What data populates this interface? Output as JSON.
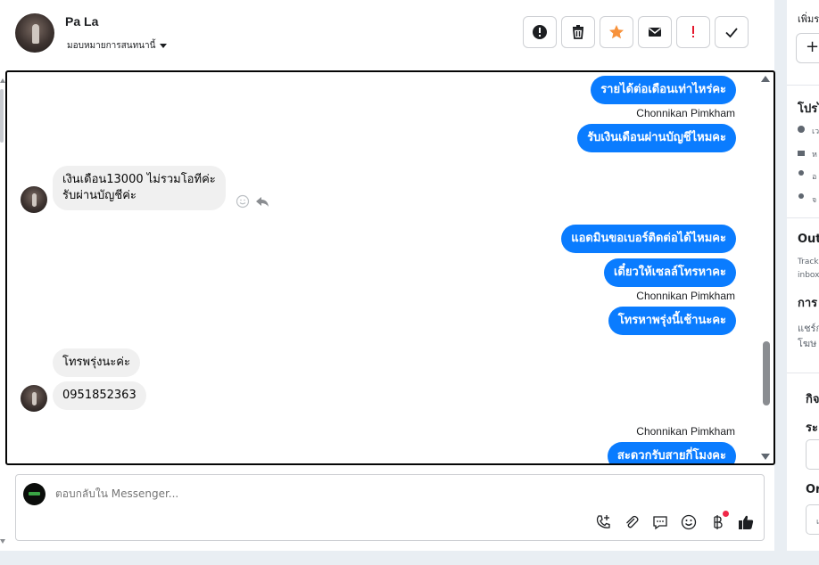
{
  "header": {
    "contact_name": "Pa La",
    "assign_label": "มอบหมายการสนทนานี้",
    "toolbar": [
      {
        "name": "spam-button",
        "icon": "alert-circle-icon"
      },
      {
        "name": "delete-button",
        "icon": "trash-icon"
      },
      {
        "name": "star-button",
        "icon": "star-icon"
      },
      {
        "name": "mark-unread-button",
        "icon": "envelope-icon"
      },
      {
        "name": "follow-up-button",
        "icon": "exclamation-icon"
      },
      {
        "name": "mark-done-button",
        "icon": "check-icon"
      }
    ]
  },
  "messages": [
    {
      "dir": "out",
      "text": "รายได้ต่อเดือนเท่าไหร่คะ"
    },
    {
      "sender": "Chonnikan Pimkham"
    },
    {
      "dir": "out",
      "text": "รับเงินเดือนผ่านบัญชีไหมคะ"
    },
    {
      "dir": "in",
      "text": "เงินเดือน13000 ไม่รวมโอทีค่ะ\nรับผ่านบัญชีค่ะ"
    },
    {
      "dir": "out",
      "text": "แอดมินขอเบอร์ติดต่อได้ไหมคะ"
    },
    {
      "dir": "out",
      "text": "เดี๋ยวให้เซลล์โทรหาคะ"
    },
    {
      "sender": "Chonnikan Pimkham"
    },
    {
      "dir": "out",
      "text": "โทรหาพรุ่งนี้เช้านะคะ"
    },
    {
      "dir": "in",
      "text": "โทรพรุ่งนะค่ะ"
    },
    {
      "dir": "in",
      "text": "0951852363"
    },
    {
      "sender": "Chonnikan Pimkham"
    },
    {
      "dir": "out",
      "text": "สะดวกรับสายกี่โมงคะ"
    }
  ],
  "reply": {
    "placeholder": "ตอบกลับใน Messenger..."
  },
  "right_panel": {
    "top_label": "เพิ่มร",
    "add_label": "+",
    "profile_heading": "โปรไ",
    "rows": [
      "เว",
      "ห",
      "อ",
      "จ"
    ],
    "outbox_heading": "Out",
    "outbox_desc_1": "Track",
    "outbox_desc_2": "inbox",
    "section2_heading": "การ",
    "section2_text_1": "แชร์ก",
    "section2_text_2": "โฆษ",
    "section3_heading": "กิจ",
    "section3_label": "ระ",
    "section4_label": "Or",
    "section4_input": "เ"
  },
  "colors": {
    "accent": "#0a7cff",
    "star": "#f7923b",
    "follow_up": "#e4182d",
    "notification": "#f02849"
  }
}
